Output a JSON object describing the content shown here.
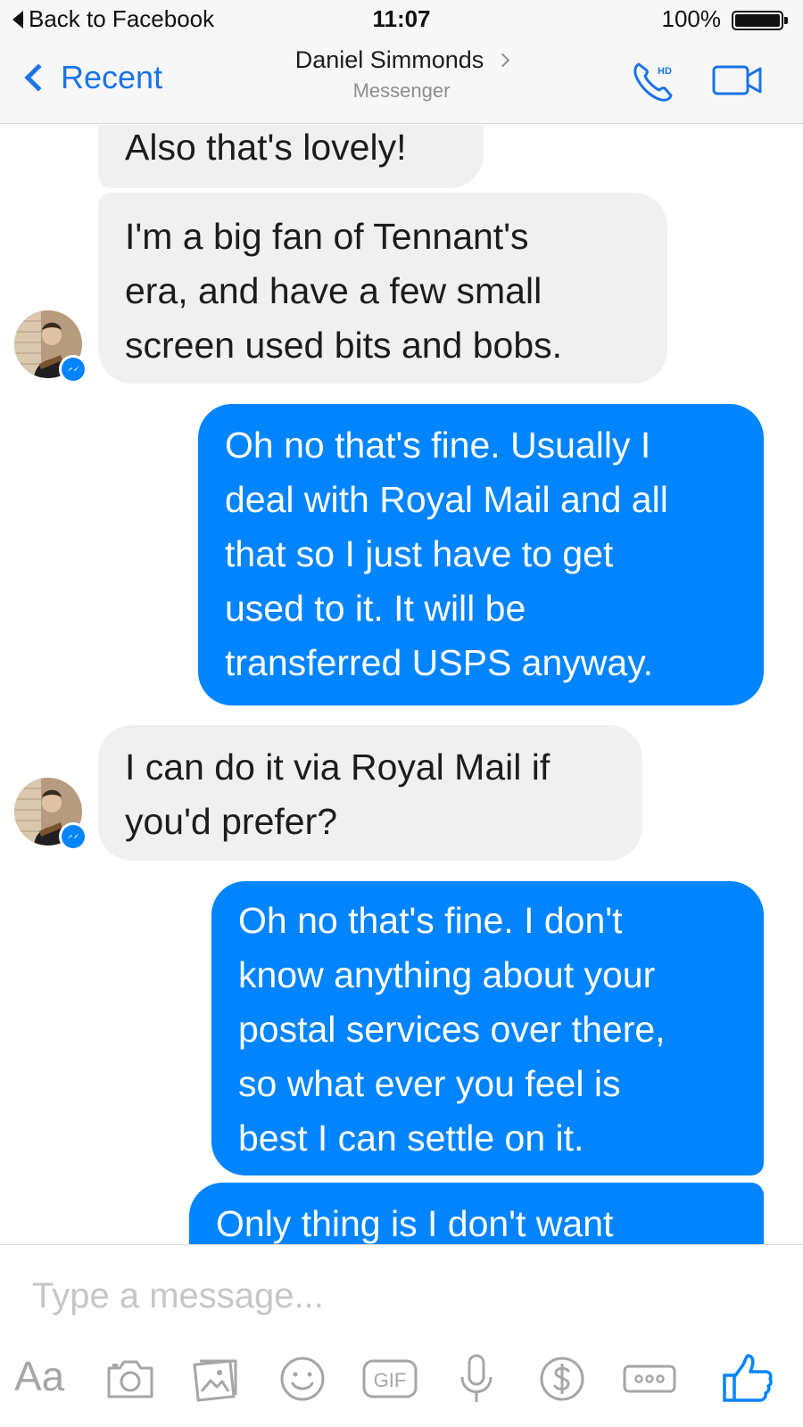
{
  "status_bar": {
    "back_label": "Back to Facebook",
    "time": "11:07",
    "battery_percent": "100%"
  },
  "nav": {
    "back_label": "Recent",
    "contact_name": "Daniel Simmonds",
    "subtitle": "Messenger",
    "phone_icon": "phone-hd-icon",
    "phone_badge": "HD",
    "video_icon": "video-camera-icon",
    "accent_color": "#1a73e8"
  },
  "messages": [
    {
      "direction": "incoming",
      "lines": [
        "Also that's lovely!"
      ]
    },
    {
      "direction": "incoming",
      "lines": [
        "I'm a big fan of Tennant's",
        "era, and have a few small",
        "screen used bits and bobs."
      ]
    },
    {
      "direction": "outgoing",
      "lines": [
        "Oh no that's fine. Usually I",
        "deal with Royal Mail and all",
        "that so I just have to get",
        "used to it. It will be",
        "transferred USPS anyway."
      ]
    },
    {
      "direction": "incoming",
      "lines": [
        "I can do it via Royal Mail if",
        "you'd prefer?"
      ]
    },
    {
      "direction": "outgoing",
      "lines": [
        "Oh no that's fine. I don't",
        "know anything about your",
        "postal services over there,",
        "so what ever you feel is",
        "best I can settle on it."
      ]
    },
    {
      "direction": "outgoing",
      "lines": [
        "Only thing is I don't want"
      ]
    }
  ],
  "colors": {
    "outgoing_bubble": "#0084ff",
    "incoming_bubble": "#f1f0f0",
    "messenger_badge": "#0084ff"
  },
  "composer": {
    "placeholder": "Type a message...",
    "text_tool_label": "Aa",
    "gif_label": "GIF",
    "tools": [
      "text-format-icon",
      "camera-icon",
      "photo-gallery-icon",
      "emoji-icon",
      "gif-icon",
      "microphone-icon",
      "payment-dollar-icon",
      "more-options-icon",
      "thumbs-up-icon"
    ]
  }
}
